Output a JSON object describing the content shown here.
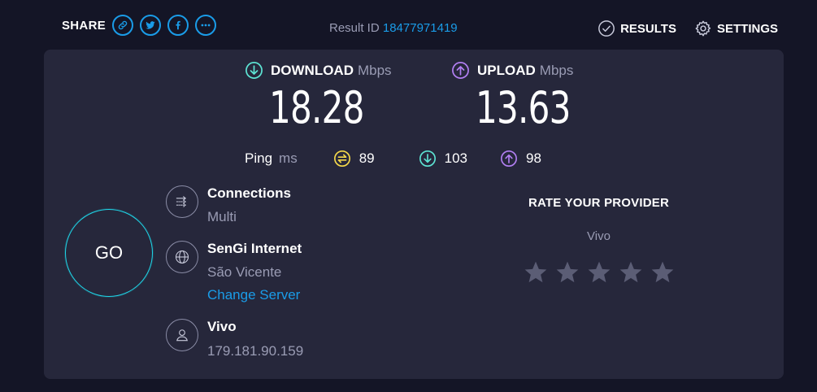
{
  "header": {
    "share_label": "SHARE",
    "share_buttons": [
      {
        "icon": "link-icon"
      },
      {
        "icon": "twitter-icon"
      },
      {
        "icon": "facebook-icon"
      },
      {
        "icon": "more-icon"
      }
    ],
    "result_id_label": "Result ID",
    "result_id_value": "18477971419",
    "results_label": "RESULTS",
    "settings_label": "SETTINGS"
  },
  "download": {
    "label": "DOWNLOAD",
    "unit": "Mbps",
    "value": "18.28",
    "color": "#5de3d3"
  },
  "upload": {
    "label": "UPLOAD",
    "unit": "Mbps",
    "value": "13.63",
    "color": "#b27ff2"
  },
  "ping": {
    "label": "Ping",
    "unit": "ms",
    "idle": "89",
    "download": "103",
    "upload": "98",
    "idle_color": "#f5d94a"
  },
  "go_label": "GO",
  "connections": {
    "title": "Connections",
    "value": "Multi"
  },
  "server": {
    "name": "SenGi Internet",
    "location": "São Vicente",
    "change_label": "Change Server"
  },
  "isp": {
    "name": "Vivo",
    "ip": "179.181.90.159"
  },
  "rate": {
    "title": "RATE YOUR PROVIDER",
    "provider": "Vivo",
    "stars": 5,
    "star_color": "#5b5d75"
  },
  "colors": {
    "accent": "#1a9ce8",
    "background": "#141526",
    "panel": "#26273b",
    "go_ring": "#1fd6e8"
  }
}
